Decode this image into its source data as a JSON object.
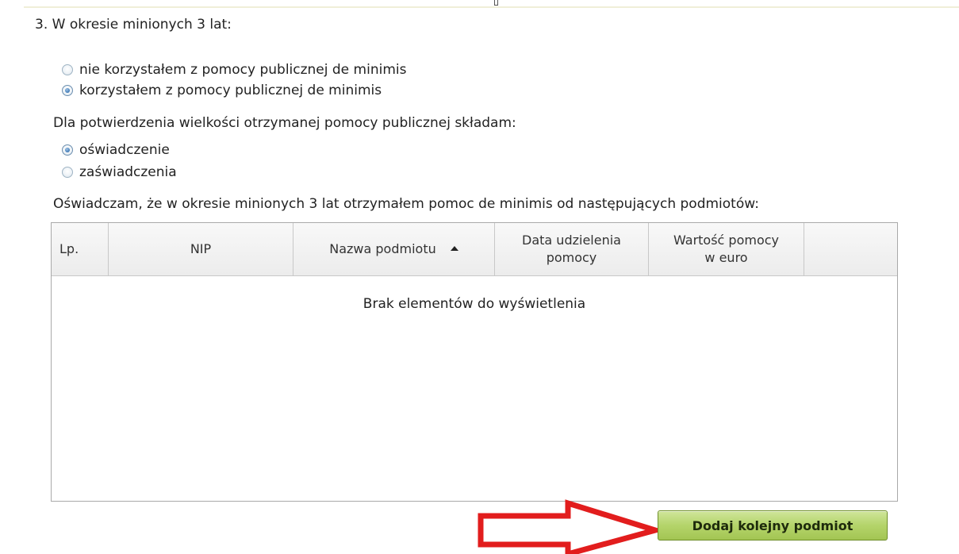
{
  "section": {
    "heading": "3. W okresie minionych 3 lat:"
  },
  "aid_usage": {
    "options": [
      {
        "label": "nie korzystałem z pomocy publicznej de minimis",
        "checked": false
      },
      {
        "label": "korzystałem z pomocy publicznej de minimis",
        "checked": true
      }
    ]
  },
  "confirmation": {
    "prompt": "Dla potwierdzenia wielkości otrzymanej pomocy publicznej składam:",
    "options": [
      {
        "label": "oświadczenie",
        "checked": true
      },
      {
        "label": "zaświadczenia",
        "checked": false
      }
    ]
  },
  "declaration": {
    "text": "Oświadczam, że w okresie minionych 3 lat otrzymałem pomoc de minimis od następujących podmiotów:"
  },
  "grid": {
    "columns": {
      "lp": "Lp.",
      "nip": "NIP",
      "nazwa": "Nazwa podmiotu",
      "data_line1": "Data udzielenia",
      "data_line2": "pomocy",
      "wartosc_line1": "Wartość pomocy",
      "wartosc_line2": "w euro"
    },
    "sort": {
      "column": "nazwa",
      "direction": "ascending"
    },
    "rows": [],
    "empty_message": "Brak elementów do wyświetlenia"
  },
  "actions": {
    "add_label": "Dodaj kolejny podmiot"
  },
  "colors": {
    "button_green": "#b4d46a",
    "annotation_arrow": "#e21d1d",
    "radio_selected": "#3f79b5"
  },
  "icons": {
    "sort": "sort-ascending-icon",
    "annotation": "red-arrow-annotation"
  }
}
